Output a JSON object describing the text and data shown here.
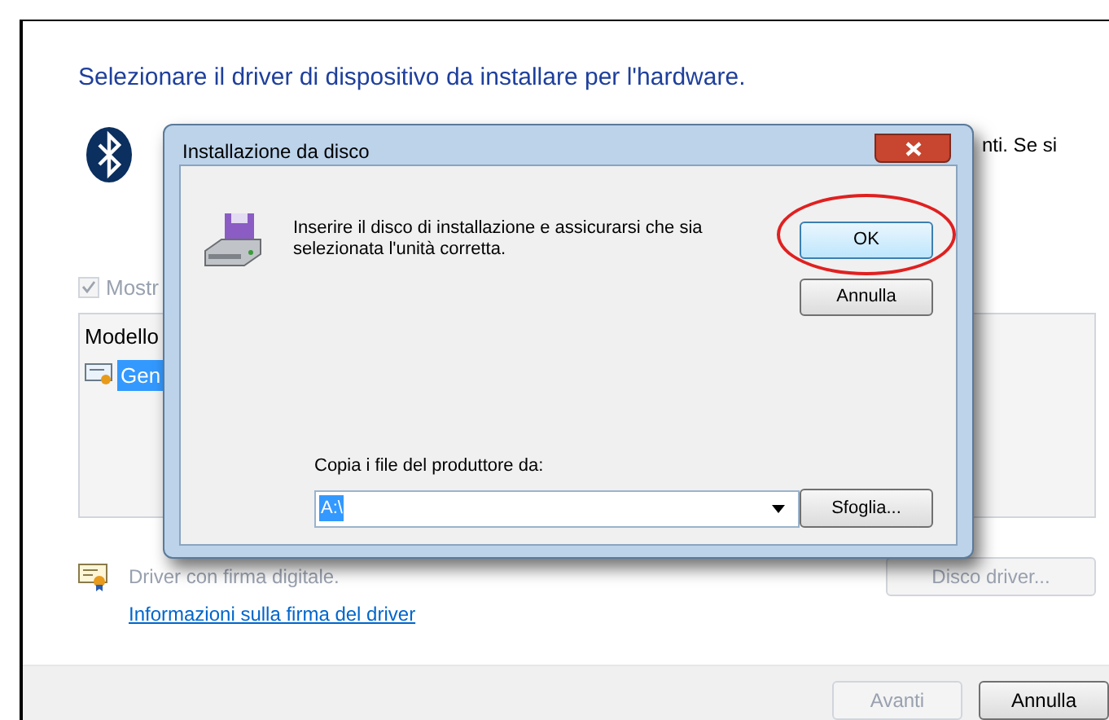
{
  "window": {
    "heading": "Selezionare il driver di dispositivo da installare per l'hardware.",
    "description_tail": "nti. Se si",
    "show_compatible": {
      "label": "Mostr",
      "checked": true,
      "disabled": true
    },
    "model_list": {
      "header": "Modello",
      "items": [
        {
          "label": "Gen",
          "selected": true
        }
      ]
    },
    "signature": {
      "text": "Driver con firma digitale.",
      "link": "Informazioni sulla firma del driver"
    },
    "have_disk_button": {
      "label": "Disco driver...",
      "disabled": true
    },
    "buttons": [
      {
        "label": "Avanti",
        "disabled": true
      },
      {
        "label": "Annulla",
        "disabled": false
      }
    ]
  },
  "dialog": {
    "title": "Installazione da disco",
    "message": "Inserire il disco di installazione e assicurarsi che sia selezionata l'unità corretta.",
    "buttons": [
      {
        "label": "OK",
        "circled": true
      },
      {
        "label": "Annulla",
        "circled": false
      }
    ],
    "copy_label": "Copia i file del produttore da:",
    "path": {
      "value": "A:\\"
    },
    "browse_button": "Sfoglia..."
  }
}
